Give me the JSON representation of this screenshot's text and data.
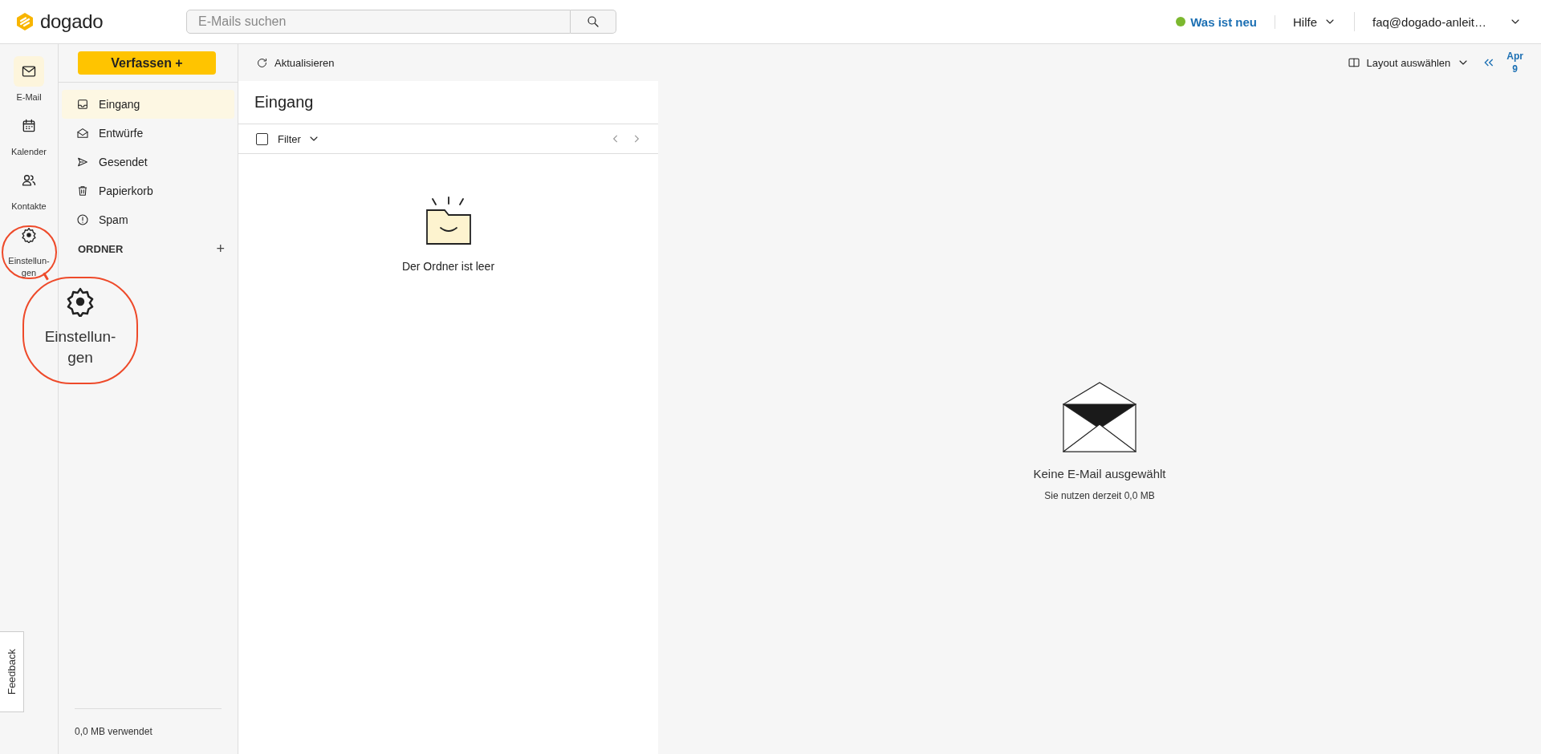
{
  "header": {
    "logo": "dogado",
    "search": {
      "placeholder": "E-Mails suchen"
    },
    "whats_new": {
      "label": "Was ist neu",
      "color": "#7cb82f"
    },
    "help": "Hilfe",
    "account": "faq@dogado-anleit…"
  },
  "rail": [
    {
      "label": "E-Mail",
      "kind": "mail",
      "selected": true
    },
    {
      "label": "Kalender",
      "kind": "calendar",
      "selected": false
    },
    {
      "label": "Kontakte",
      "kind": "contacts",
      "selected": false
    },
    {
      "label": "Einstellun-gen",
      "kind": "settings",
      "selected": false
    }
  ],
  "feedback": "Feedback",
  "sidebar": {
    "compose": "Verfassen +",
    "folders": [
      {
        "label": "Eingang",
        "kind": "inbox",
        "selected": true
      },
      {
        "label": "Entwürfe",
        "kind": "drafts",
        "selected": false
      },
      {
        "label": "Gesendet",
        "kind": "sent",
        "selected": false
      },
      {
        "label": "Papierkorb",
        "kind": "trash",
        "selected": false
      },
      {
        "label": "Spam",
        "kind": "spam",
        "selected": false
      }
    ],
    "section": "ORDNER",
    "add": "+",
    "storage": "0,0 MB verwendet"
  },
  "toolbar": {
    "refresh": "Aktualisieren",
    "layout": "Layout auswählen",
    "month": "Apr",
    "day": "9"
  },
  "list": {
    "title": "Eingang",
    "filter": {
      "label": "Filter",
      "checked": false
    },
    "empty": "Der Ordner ist leer"
  },
  "reading_pane": {
    "title": "Keine E-Mail ausgewählt",
    "usage": "Sie nutzen derzeit 0,0 MB"
  },
  "callout": {
    "label": "Einstellun-gen"
  }
}
